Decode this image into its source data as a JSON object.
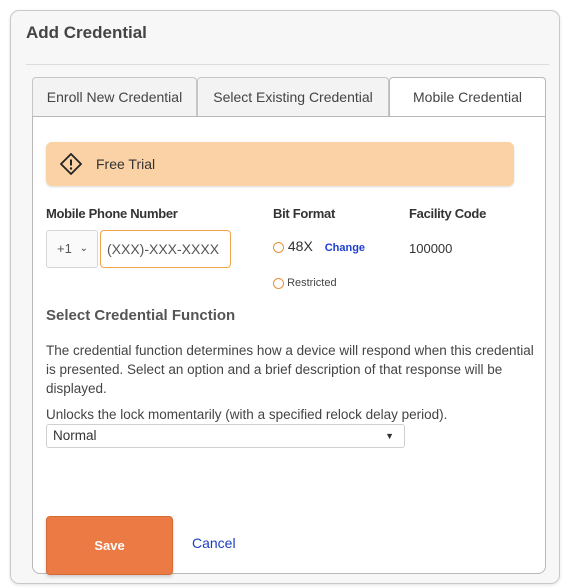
{
  "dialog": {
    "title": "Add Credential"
  },
  "tabs": [
    {
      "label": "Enroll New Credential",
      "active": false
    },
    {
      "label": "Select Existing Credential",
      "active": false
    },
    {
      "label": "Mobile Credential",
      "active": true
    }
  ],
  "banner": {
    "icon": "diamond-warning-icon",
    "text": "Free Trial",
    "color": "#fbd2a6"
  },
  "phone": {
    "label": "Mobile Phone Number",
    "country_code": "+1",
    "placeholder": "(XXX)-XXX-XXXX",
    "value": ""
  },
  "bit_format": {
    "label": "Bit Format",
    "value": "48X",
    "change_label": "Change",
    "restricted_label": "Restricted"
  },
  "facility": {
    "label": "Facility Code",
    "value": "100000"
  },
  "credential_function": {
    "title": "Select Credential Function",
    "description": "The credential function determines how a device will respond when this credential is presented. Select an option and a brief description of that response will be displayed.",
    "selected_description": "Unlocks the lock momentarily (with a specified relock delay period).",
    "selected": "Normal"
  },
  "actions": {
    "save_label": "Save",
    "cancel_label": "Cancel"
  },
  "colors": {
    "accent": "#ec7a45",
    "link": "#1f3fd1",
    "input_focus": "#f2a44d"
  }
}
